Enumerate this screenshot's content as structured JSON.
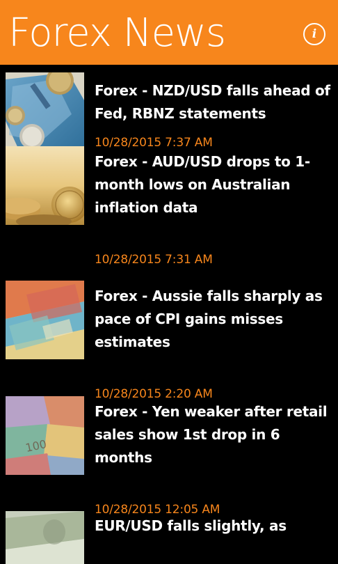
{
  "header": {
    "title": "Forex News",
    "info_icon": "info-icon",
    "accent_color": "#f7861c"
  },
  "news": [
    {
      "headline": "Forex - NZD/USD falls ahead of Fed, RBNZ statements",
      "timestamp": "10/28/2015 7:37 AM",
      "thumbnail": "nz-dollar-banknote-coins"
    },
    {
      "headline": "Forex - AUD/USD drops to 1-month lows on Australian inflation data",
      "timestamp": "10/28/2015 7:31 AM",
      "thumbnail": "gold-coins"
    },
    {
      "headline": "Forex - Aussie falls sharply as pace of CPI gains misses estimates",
      "timestamp": "10/28/2015 2:20 AM",
      "thumbnail": "australian-banknotes"
    },
    {
      "headline": "Forex - Yen weaker after retail sales show 1st drop in 6 months",
      "timestamp": "10/28/2015 12:05 AM",
      "thumbnail": "mixed-banknotes"
    },
    {
      "headline": "EUR/USD falls slightly, as",
      "timestamp": "",
      "thumbnail": "us-dollar-banknotes"
    }
  ]
}
